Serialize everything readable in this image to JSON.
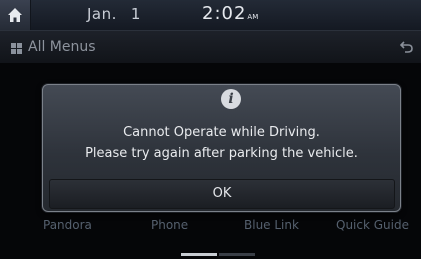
{
  "status_bar": {
    "date_month": "Jan.",
    "date_day": "1",
    "time": "2:02",
    "ampm": "AM"
  },
  "title_bar": {
    "title": "All Menus"
  },
  "menu_items": [
    {
      "label": "Pandora"
    },
    {
      "label": "Phone"
    },
    {
      "label": "Blue Link"
    },
    {
      "label": "Quick Guide"
    }
  ],
  "dialog": {
    "icon": "info-icon",
    "message_line1": "Cannot Operate while Driving.",
    "message_line2": "Please try again after parking the vehicle.",
    "ok_label": "OK"
  },
  "icons": [
    "home-icon",
    "grid-menu-icon",
    "back-arrow-icon",
    "info-icon"
  ],
  "page_indicator": {
    "pages": 2,
    "current": 1
  }
}
